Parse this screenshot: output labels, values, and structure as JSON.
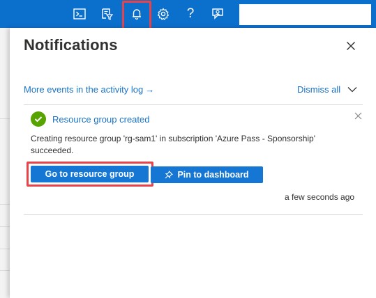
{
  "topbar": {
    "icons": [
      "cloud-shell-icon",
      "directory-filter-icon",
      "notifications-bell-icon",
      "settings-gear-icon",
      "help-icon",
      "feedback-icon"
    ],
    "help_glyph": "?",
    "search_value": ""
  },
  "panel": {
    "title": "Notifications",
    "activity_link": "More events in the activity log",
    "activity_arrow": "→",
    "dismiss_all": "Dismiss all"
  },
  "notification": {
    "title": "Resource group created",
    "message": "Creating resource group 'rg-sam1' in subscription 'Azure Pass - Sponsorship' succeeded.",
    "primary_button": "Go to resource group",
    "secondary_button": "Pin to dashboard",
    "timestamp": "a few seconds ago",
    "status": "success"
  },
  "colors": {
    "topbar": "#0b6fcc",
    "accent": "#1577d3",
    "link": "#1a73c6",
    "success": "#57a300",
    "highlight": "#e8434b"
  }
}
